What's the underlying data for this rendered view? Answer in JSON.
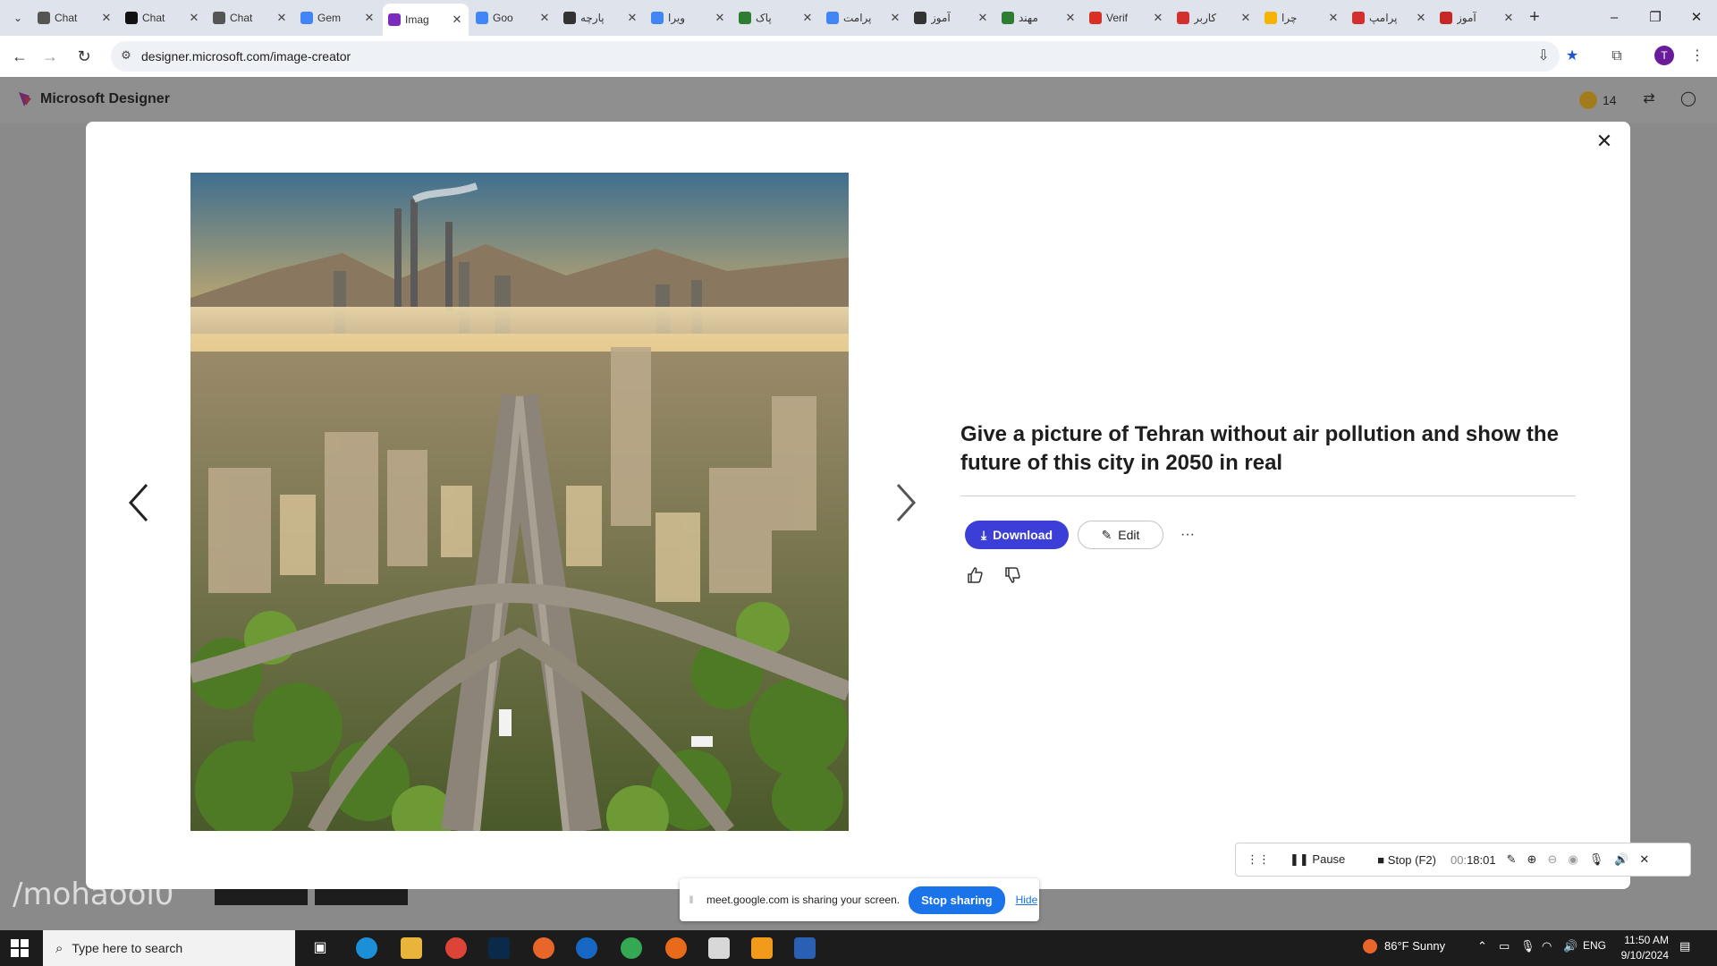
{
  "browser": {
    "tabs": [
      {
        "label": "Chat",
        "icon": "chatgpt-icon",
        "color": "#555555"
      },
      {
        "label": "Chat",
        "icon": "chatgpt-icon",
        "color": "#111111"
      },
      {
        "label": "Chat",
        "icon": "chatgpt-icon",
        "color": "#555555"
      },
      {
        "label": "Gem",
        "icon": "gemini-icon",
        "color": "#4285f4"
      },
      {
        "label": "Imag",
        "icon": "designer-icon",
        "color": "#7b2cbf"
      },
      {
        "label": "Goo",
        "icon": "translate-icon",
        "color": "#4285f4"
      },
      {
        "label": "پارچه",
        "icon": "site-icon",
        "color": "#333333"
      },
      {
        "label": "ویرا",
        "icon": "google-icon",
        "color": "#4285f4"
      },
      {
        "label": "پاک",
        "icon": "feather-icon",
        "color": "#2e7d32"
      },
      {
        "label": "پرامت",
        "icon": "google-icon",
        "color": "#4285f4"
      },
      {
        "label": "آموز",
        "icon": "gear-icon",
        "color": "#333333"
      },
      {
        "label": "مهند",
        "icon": "site-icon",
        "color": "#2e7d32"
      },
      {
        "label": "Verif",
        "icon": "gmail-icon",
        "color": "#d93025"
      },
      {
        "label": "کاربر",
        "icon": "opera-icon",
        "color": "#d32f2f"
      },
      {
        "label": "چرا",
        "icon": "site-icon",
        "color": "#f5b400"
      },
      {
        "label": "پرامپ",
        "icon": "site-icon",
        "color": "#d32f2f"
      },
      {
        "label": "آموز",
        "icon": "site-icon",
        "color": "#c62828"
      }
    ],
    "active_tab_index": 4,
    "url": "designer.microsoft.com/image-creator",
    "profile_initial": "T"
  },
  "app": {
    "name": "Microsoft Designer",
    "coins": "14"
  },
  "modal": {
    "prompt": "Give a picture of Tehran without air pollution and show the future of this city in 2050 in real",
    "download_label": "Download",
    "edit_label": "Edit",
    "more_label": "···"
  },
  "recorder": {
    "pause_label": "Pause",
    "stop_label": "Stop",
    "stop_shortcut": "(F2)",
    "time_prefix": "00:",
    "time": "18:01"
  },
  "watermark": "/mohaooi0",
  "share_banner": {
    "message": "meet.google.com is sharing your screen.",
    "stop_label": "Stop sharing",
    "hide_label": "Hide"
  },
  "taskbar": {
    "search_placeholder": "Type here to search",
    "weather": "86°F  Sunny",
    "language": "ENG",
    "time": "11:50 AM",
    "date": "9/10/2024"
  },
  "colors": {
    "accent": "#3b3fd8",
    "share_blue": "#1a73e8"
  }
}
